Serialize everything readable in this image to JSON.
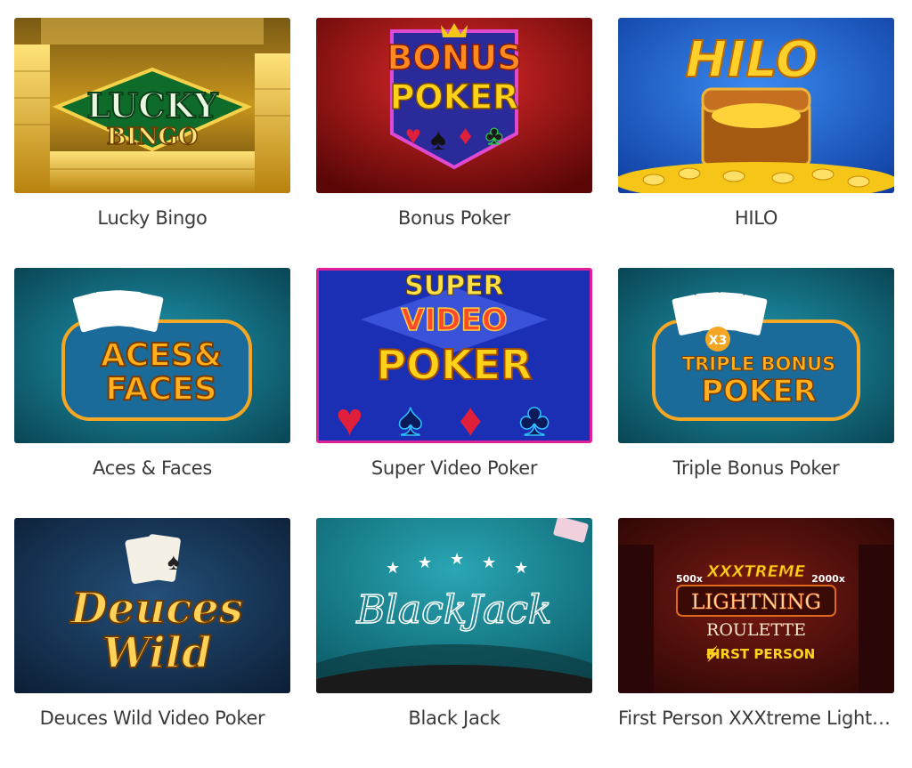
{
  "games": [
    {
      "title": "Lucky Bingo",
      "logo_lines": [
        "LUCKY",
        "BINGO"
      ]
    },
    {
      "title": "Bonus Poker",
      "logo_lines": [
        "BONUS",
        "POKER"
      ]
    },
    {
      "title": "HILO",
      "logo_lines": [
        "HILO"
      ]
    },
    {
      "title": "Aces & Faces",
      "logo_lines": [
        "ACES&",
        "FACES"
      ]
    },
    {
      "title": "Super Video Poker",
      "logo_lines": [
        "SUPER",
        "VIDEO",
        "POKER"
      ]
    },
    {
      "title": "Triple Bonus Poker",
      "logo_lines": [
        "X3",
        "TRIPLE BONUS",
        "POKER"
      ]
    },
    {
      "title": "Deuces Wild Video Poker",
      "logo_lines": [
        "Deuces",
        "Wild"
      ]
    },
    {
      "title": "Black Jack",
      "logo_lines": [
        "BlackJack"
      ]
    },
    {
      "title": "First Person XXXtreme Lightni...",
      "logo_lines": [
        "XXXTREME",
        "500x",
        "2000x",
        "LIGHTNING",
        "ROULETTE",
        "FIRST PERSON"
      ]
    }
  ],
  "colors": {
    "title_text": "#3a3a3a",
    "gold": "#f5c518",
    "bonus_red": "#c8102e",
    "hilo_blue": "#1c5fd1",
    "teal": "#0e6f86",
    "video_blue": "#1b2fb4",
    "deuces_navy": "#14304f",
    "blackjack_teal": "#1a8a9a",
    "lightning_dark": "#4a0d0d"
  }
}
